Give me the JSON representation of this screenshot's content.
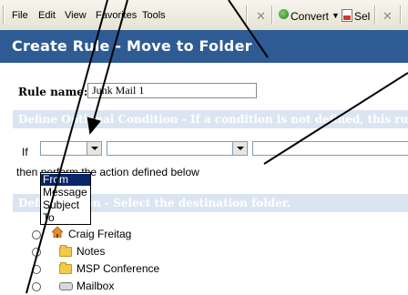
{
  "toolbar": {
    "menus": [
      "File",
      "Edit",
      "View",
      "Favorites",
      "Tools"
    ],
    "convert_label": "Convert",
    "select_label": "Sel"
  },
  "header": {
    "title": "Create Rule - Move to Folder"
  },
  "rule": {
    "label": "Rule name:",
    "value": "Junk Mail 1"
  },
  "condition_section": {
    "title": "Define Optional Condition - If a condition is not defined, this rule will a"
  },
  "condition": {
    "if_label": "If",
    "then_text": "then perform the action defined below",
    "dropdown_options": [
      "From",
      "Message",
      "Subject",
      "To"
    ],
    "selected_option": "From"
  },
  "action_section": {
    "title": "Define Action - Select the destination folder."
  },
  "folders": [
    {
      "name": "Craig Freitag",
      "icon": "home-icon"
    },
    {
      "name": "Notes",
      "icon": "folder-icon"
    },
    {
      "name": "MSP Conference",
      "icon": "folder-icon"
    },
    {
      "name": "Mailbox",
      "icon": "mailbox-icon"
    }
  ],
  "colors": {
    "header_bg": "#2e5b94",
    "section_bg": "#dbe5f1",
    "selection": "#0a246a"
  }
}
